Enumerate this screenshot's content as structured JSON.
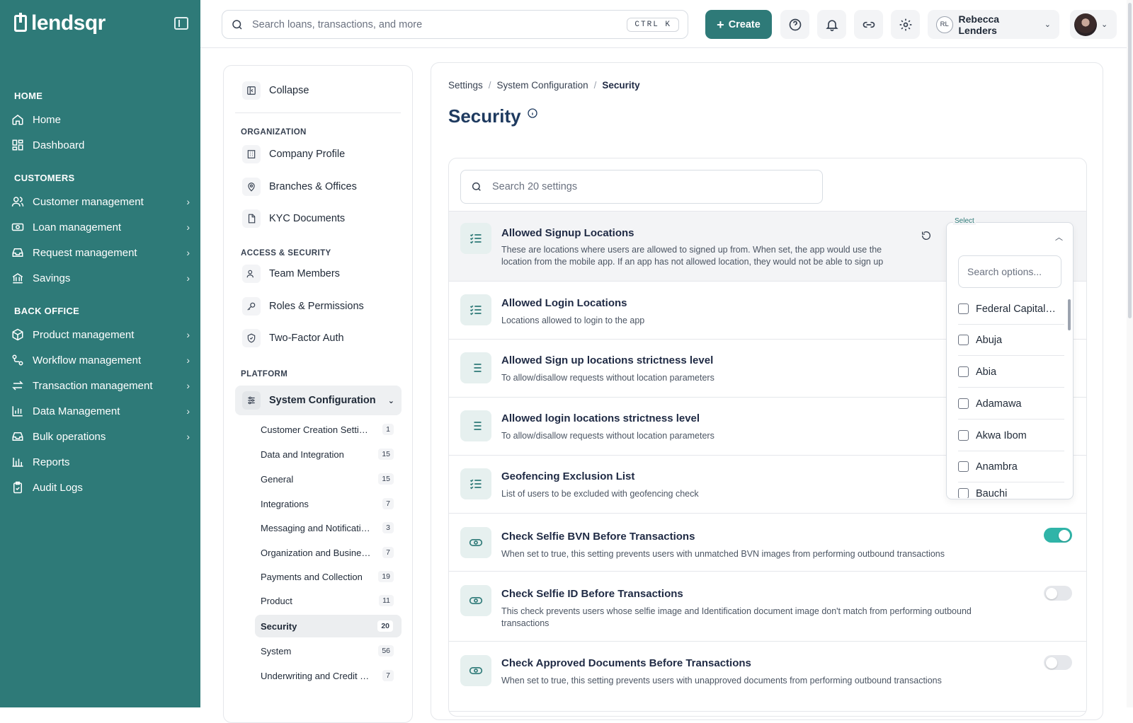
{
  "brand": {
    "name": "lendsqr"
  },
  "sidebar": {
    "sections": [
      {
        "title": "HOME",
        "items": [
          {
            "label": "Home"
          },
          {
            "label": "Dashboard"
          }
        ]
      },
      {
        "title": "CUSTOMERS",
        "items": [
          {
            "label": "Customer management"
          },
          {
            "label": "Loan management"
          },
          {
            "label": "Request management"
          },
          {
            "label": "Savings"
          }
        ]
      },
      {
        "title": "BACK OFFICE",
        "items": [
          {
            "label": "Product management"
          },
          {
            "label": "Workflow management"
          },
          {
            "label": "Transaction management"
          },
          {
            "label": "Data Management"
          },
          {
            "label": "Bulk operations"
          },
          {
            "label": "Reports"
          },
          {
            "label": "Audit Logs"
          }
        ]
      }
    ]
  },
  "topbar": {
    "search_placeholder": "Search loans, transactions, and more",
    "shortcut": "CTRL K",
    "create_label": "Create",
    "user_initials": "RL",
    "user_name": "Rebecca Lenders"
  },
  "subnav": {
    "collapse_label": "Collapse",
    "org_heading": "ORGANIZATION",
    "org_items": [
      {
        "label": "Company Profile"
      },
      {
        "label": "Branches & Offices"
      },
      {
        "label": "KYC Documents"
      }
    ],
    "access_heading": "ACCESS & SECURITY",
    "access_items": [
      {
        "label": "Team Members"
      },
      {
        "label": "Roles & Permissions"
      },
      {
        "label": "Two-Factor Auth"
      }
    ],
    "platform_heading": "PLATFORM",
    "system_config_label": "System Configuration",
    "children": [
      {
        "label": "Customer Creation Setti…",
        "count": "1"
      },
      {
        "label": "Data and Integration",
        "count": "15"
      },
      {
        "label": "General",
        "count": "15"
      },
      {
        "label": "Integrations",
        "count": "7"
      },
      {
        "label": "Messaging and Notificati…",
        "count": "3"
      },
      {
        "label": "Organization and Busine…",
        "count": "7"
      },
      {
        "label": "Payments and Collection",
        "count": "19"
      },
      {
        "label": "Product",
        "count": "11"
      },
      {
        "label": "Security",
        "count": "20"
      },
      {
        "label": "System",
        "count": "56"
      },
      {
        "label": "Underwriting and Credit …",
        "count": "7"
      }
    ]
  },
  "main": {
    "breadcrumb": [
      "Settings",
      "System Configuration",
      "Security"
    ],
    "title": "Security",
    "settings_search_placeholder": "Search 20 settings",
    "settings": [
      {
        "title": "Allowed Signup Locations",
        "desc": "These are locations where users are allowed to signed up from. When set, the app would use the location from the mobile app. If an app has not allowed location, they would not be able to sign up",
        "icon": "checklist-icon"
      },
      {
        "title": "Allowed Login Locations",
        "desc": "Locations allowed to login to the app",
        "icon": "checklist-icon"
      },
      {
        "title": "Allowed Sign up locations strictness level",
        "desc": "To allow/disallow requests without location parameters",
        "icon": "list-icon"
      },
      {
        "title": "Allowed login locations strictness level",
        "desc": "To allow/disallow requests without location parameters",
        "icon": "list-icon"
      },
      {
        "title": "Geofencing Exclusion List",
        "desc": "List of users to be excluded with geofencing check",
        "icon": "checklist-icon"
      },
      {
        "title": "Check Selfie BVN Before Transactions",
        "desc": "When set to true, this setting prevents users with unmatched BVN images from performing outbound transactions",
        "icon": "toggle-icon",
        "enabled": true
      },
      {
        "title": "Check Selfie ID Before Transactions",
        "desc": "This check prevents users whose selfie image and Identification document image don't match from performing outbound transactions",
        "icon": "toggle-icon",
        "enabled": false
      },
      {
        "title": "Check Approved Documents Before Transactions",
        "desc": "When set to true, this setting prevents users with unapproved documents from performing outbound transactions",
        "icon": "toggle-icon",
        "enabled": false
      }
    ],
    "dropdown": {
      "label": "Select",
      "search_placeholder": "Search options...",
      "options": [
        "Federal Capital …",
        "Abuja",
        "Abia",
        "Adamawa",
        "Akwa Ibom",
        "Anambra",
        "Bauchi"
      ]
    }
  },
  "colors": {
    "brand": "#2e7a78",
    "toggle_on": "#30b4a8",
    "title": "#1e3a5f"
  }
}
